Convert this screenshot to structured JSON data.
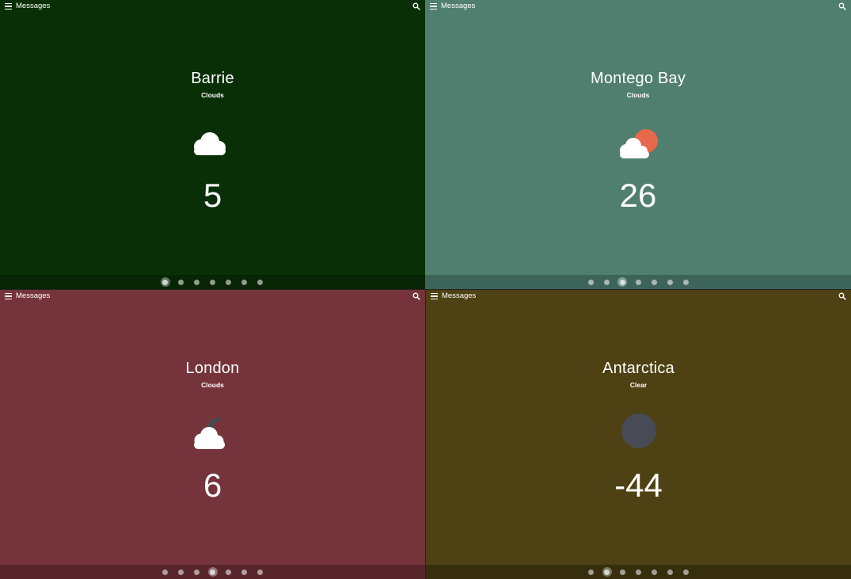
{
  "panels": [
    {
      "topbar_title": "Messages",
      "city": "Barrie",
      "condition": "Clouds",
      "temperature": "5",
      "icon": "cloud-icon",
      "colors": {
        "background": "#092f06",
        "bottombar": "#072405"
      },
      "pager": {
        "count": 7,
        "active": 0
      }
    },
    {
      "topbar_title": "Messages",
      "city": "Montego Bay",
      "condition": "Clouds",
      "temperature": "26",
      "icon": "partly-sunny-icon",
      "colors": {
        "background": "#507f6f",
        "bottombar": "#3d6458",
        "sun": "#e5694a"
      },
      "pager": {
        "count": 7,
        "active": 2
      }
    },
    {
      "topbar_title": "Messages",
      "city": "London",
      "condition": "Clouds",
      "temperature": "6",
      "icon": "cloud-night-icon",
      "colors": {
        "background": "#75343b",
        "bottombar": "#58252b",
        "moon": "#454a55"
      },
      "pager": {
        "count": 7,
        "active": 3
      }
    },
    {
      "topbar_title": "Messages",
      "city": "Antarctica",
      "condition": "Clear",
      "temperature": "-44",
      "icon": "moon-icon",
      "colors": {
        "background": "#4e4113",
        "bottombar": "#372e0d",
        "moon": "#484a55"
      },
      "pager": {
        "count": 7,
        "active": 1
      }
    }
  ]
}
